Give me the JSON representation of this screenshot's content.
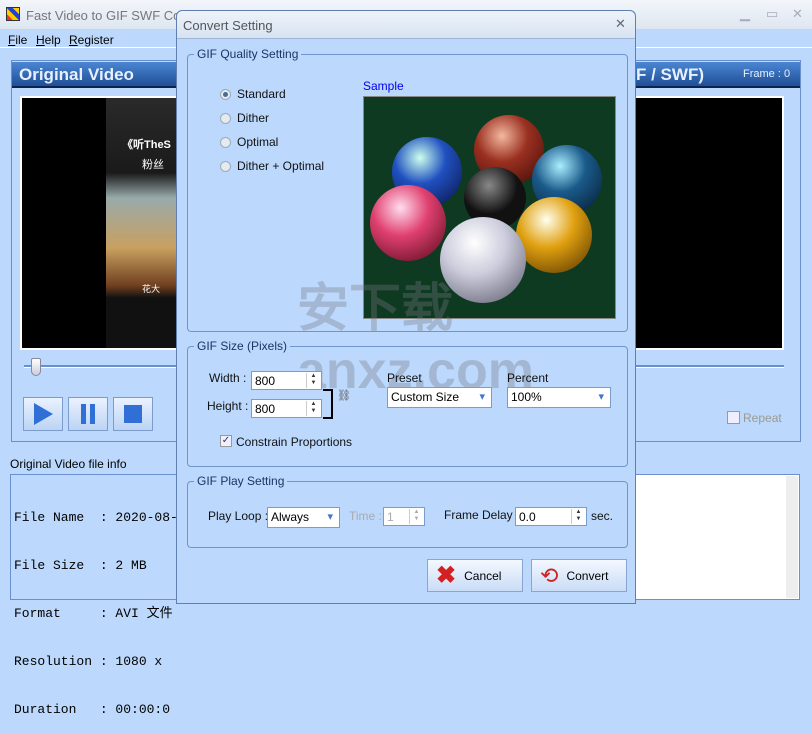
{
  "app": {
    "title": "Fast Video to GIF SWF Co",
    "menu": [
      "File",
      "Help",
      "Register"
    ],
    "window_controls": [
      "minimize",
      "maximize",
      "close"
    ]
  },
  "left_panel": {
    "header": "Original Video",
    "repeat_label": "Repeat",
    "repeat_checked": false,
    "slider_position": 0
  },
  "right_panel": {
    "header": "F / SWF)",
    "frame": "Frame : 0"
  },
  "file_info": {
    "label": "Original Video file info",
    "lines": [
      "File Name  : 2020-08-",
      "File Size  : 2 MB",
      "Format     : AVI 文件",
      "Resolution : 1080 x ",
      "Duration   : 00:00:0"
    ]
  },
  "video_overlay": {
    "line1": "《听TheS",
    "line2": "粉丝",
    "line3": "花大"
  },
  "watermark": "安下载 anxz.com",
  "dialog": {
    "title": "Convert Setting",
    "quality": {
      "legend": "GIF Quality Setting",
      "options": [
        "Standard",
        "Dither",
        "Optimal",
        "Dither + Optimal"
      ],
      "selected": "Standard",
      "sample_label": "Sample"
    },
    "size": {
      "legend": "GIF Size (Pixels)",
      "width_label": "Width :",
      "width": "800",
      "height_label": "Height :",
      "height": "800",
      "preset_label": "Preset",
      "preset": "Custom Size",
      "percent_label": "Percent",
      "percent": "100%",
      "constrain_label": "Constrain Proportions",
      "constrain_checked": true
    },
    "play": {
      "legend": "GIF Play Setting",
      "loop_label": "Play Loop :",
      "loop": "Always",
      "time_label": "Time :",
      "time": "1",
      "delay_label": "Frame Delay :",
      "delay": "0.0",
      "sec": "sec."
    },
    "cancel": "Cancel",
    "convert": "Convert"
  },
  "colors": {
    "background": "#bcd9fd",
    "header": "#1f4f95",
    "sample_link": "#0000ee"
  }
}
